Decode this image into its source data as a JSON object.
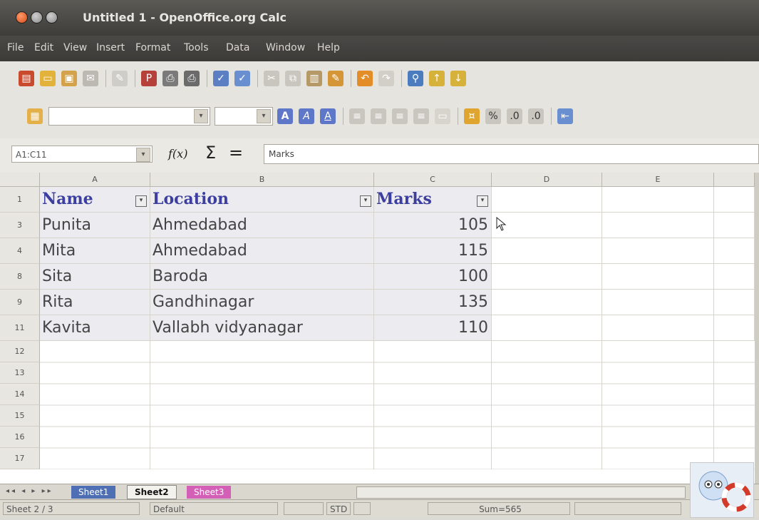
{
  "window": {
    "title": "Untitled 1 - OpenOffice.org Calc"
  },
  "menu": [
    "File",
    "Edit",
    "View",
    "Insert",
    "Format",
    "Tools",
    "Data",
    "Window",
    "Help"
  ],
  "formula_bar": {
    "name_box": "A1:C11",
    "content": "Marks",
    "function_symbol": "f(x)",
    "sum_symbol": "Σ",
    "equals_symbol": "="
  },
  "columns": [
    "A",
    "B",
    "C",
    "D",
    "E"
  ],
  "header_row": {
    "row_label": "1",
    "name": "Name",
    "location": "Location",
    "marks": "Marks"
  },
  "rows": [
    {
      "row_label": "3",
      "name": "Punita",
      "location": "Ahmedabad",
      "marks": "105"
    },
    {
      "row_label": "4",
      "name": "Mita",
      "location": "Ahmedabad",
      "marks": "115"
    },
    {
      "row_label": "8",
      "name": "Sita",
      "location": "Baroda",
      "marks": "100"
    },
    {
      "row_label": "9",
      "name": "Rita",
      "location": "Gandhinagar",
      "marks": "135"
    },
    {
      "row_label": "11",
      "name": "Kavita",
      "location": "Vallabh vidyanagar",
      "marks": "110"
    }
  ],
  "empty_rows": [
    "12",
    "13",
    "14",
    "15",
    "16",
    "17"
  ],
  "sheet_tabs": [
    "Sheet1",
    "Sheet2",
    "Sheet3"
  ],
  "active_sheet": "Sheet2",
  "status": {
    "sheet": "Sheet 2 / 3",
    "style": "Default",
    "mode": "STD",
    "sum": "Sum=565"
  },
  "colors": {
    "header_text": "#3c3fa0",
    "selection": "#ecebef",
    "sheet1_tab": "#4e6fb3",
    "sheet3_tab": "#d35fb7"
  }
}
